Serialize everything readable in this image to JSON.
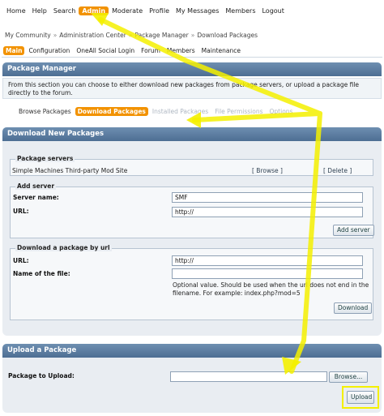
{
  "top_menu": {
    "items": [
      {
        "label": "Home"
      },
      {
        "label": "Help"
      },
      {
        "label": "Search"
      },
      {
        "label": "Admin",
        "active": true
      },
      {
        "label": "Moderate"
      },
      {
        "label": "Profile"
      },
      {
        "label": "My Messages"
      },
      {
        "label": "Members"
      },
      {
        "label": "Logout"
      }
    ]
  },
  "breadcrumb": [
    "My Community",
    "Administration Center",
    "Package Manager",
    "Download Packages"
  ],
  "breadcrumb_sep": "»",
  "admin_menu": {
    "items": [
      {
        "label": "Main",
        "active": true
      },
      {
        "label": "Configuration"
      },
      {
        "label": "OneAll Social Login"
      },
      {
        "label": "Forum"
      },
      {
        "label": "Members"
      },
      {
        "label": "Maintenance"
      }
    ]
  },
  "package_manager": {
    "title": "Package Manager",
    "description": "From this section you can choose to either download new packages from package servers, or upload a package file directly to the forum.",
    "tabs": [
      {
        "label": "Browse Packages"
      },
      {
        "label": "Download Packages",
        "active": true
      },
      {
        "label": "Installed Packages"
      },
      {
        "label": "File Permissions"
      },
      {
        "label": "Options"
      }
    ]
  },
  "download": {
    "title": "Download New Packages",
    "servers_legend": "Package servers",
    "server_name": "Simple Machines Third-party Mod Site",
    "browse_link": "[ Browse ]",
    "delete_link": "[ Delete ]",
    "add_server_legend": "Add server",
    "server_name_label": "Server name:",
    "server_name_value": "SMF",
    "url_label": "URL:",
    "url_value": "http://",
    "add_server_button": "Add server",
    "by_url_legend": "Download a package by url",
    "dl_url_label": "URL:",
    "dl_url_value": "http://",
    "file_name_label": "Name of the file:",
    "file_name_value": "",
    "optional_note": "Optional value. Should be used when the url does not end in the filename. For example: index.php?mod=5",
    "download_button": "Download"
  },
  "upload": {
    "title": "Upload a Package",
    "label": "Package to Upload:",
    "file_value": "",
    "browse_button": "Browse...",
    "upload_button": "Upload"
  },
  "colors": {
    "accent": "#f29200",
    "header": "#5b7ca1",
    "annotation": "#f4f000"
  }
}
